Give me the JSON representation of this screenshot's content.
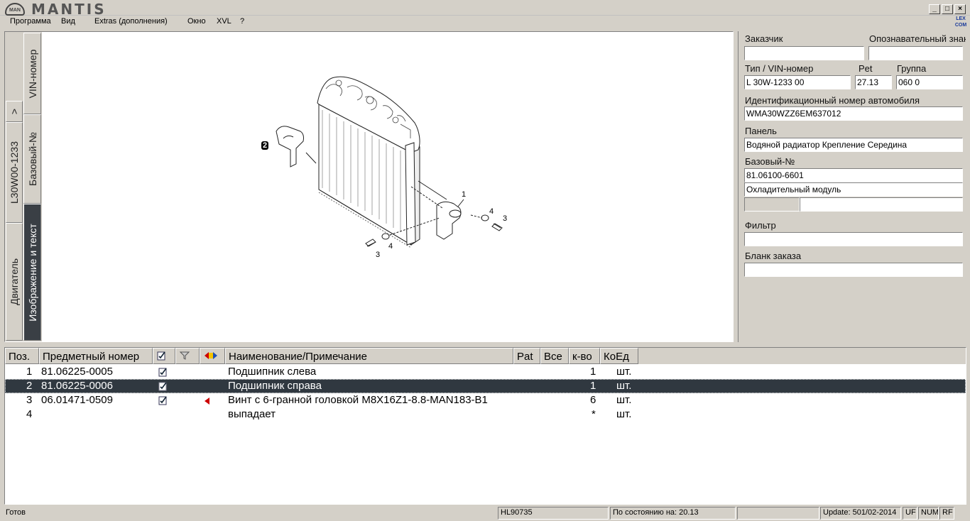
{
  "window": {
    "app_title": "MANTIS",
    "logo_text": "MAN"
  },
  "menu": [
    "Программа",
    "Вид",
    "Extras (дополнения)",
    "Окно",
    "XVL",
    "?"
  ],
  "vtabs": [
    "VIN-номер",
    "Базовый-№",
    "Изображение и текст",
    "L30W00-1233",
    "Двигатель",
    ">"
  ],
  "image_callouts": [
    "1",
    "2",
    "3",
    "4",
    "3",
    "4"
  ],
  "form": {
    "customer_label": "Заказчик",
    "customer_value": "",
    "identifier_label": "Опознавательный знак",
    "identifier_value": "",
    "type_vin_label": "Тип / VIN-номер",
    "type_vin_value": "L 30W-1233 00",
    "pet_label": "Рet",
    "pet_value": "27.13",
    "group_label": "Группа",
    "group_value": "060 0",
    "vin_label": "Идентификационный номер автомобиля",
    "vin_value": "WMA30WZZ6EM637012",
    "panel_label": "Панель",
    "panel_value": "Водяной радиатор Крепление Середина",
    "base_no_label": "Базовый-№",
    "base_no_value": "81.06100-6601",
    "base_no_desc": "Охладительный модуль",
    "filter_label": "Фильтр",
    "filter_value": "",
    "order_label": "Бланк заказа",
    "order_value": ""
  },
  "table": {
    "headers": [
      "Поз.",
      "Предметный номер",
      "",
      "",
      "",
      "Наименование/Примечание",
      "Рat",
      "Все",
      "к-во",
      "КоЕд"
    ],
    "rows": [
      {
        "pos": "1",
        "part": "81.06225-0005",
        "name": "Подшипник слева",
        "qty": "1",
        "unit": "шт.",
        "selected": false,
        "marker": false,
        "check": true
      },
      {
        "pos": "2",
        "part": "81.06225-0006",
        "name": "Подшипник справа",
        "qty": "1",
        "unit": "шт.",
        "selected": true,
        "marker": false,
        "check": true
      },
      {
        "pos": "3",
        "part": "06.01471-0509",
        "name": "Винт с 6-гранной головкой M8X16Z1-8.8-MAN183-B1",
        "qty": "6",
        "unit": "шт.",
        "selected": false,
        "marker": true,
        "check": true
      },
      {
        "pos": "4",
        "part": "",
        "name": "выпадает",
        "qty": "*",
        "unit": "шт.",
        "selected": false,
        "marker": false,
        "check": false
      }
    ]
  },
  "status": {
    "ready": "Готов",
    "code": "HL90735",
    "as_of": "По состоянию на: 20.13",
    "empty": "",
    "update": "Update: 501/02-2014",
    "uf": "UF",
    "num": "NUM",
    "rf": "RF"
  },
  "colors": {
    "selection": "#303840",
    "marker": "#cc0000",
    "window_bg": "#d4d0c8"
  }
}
